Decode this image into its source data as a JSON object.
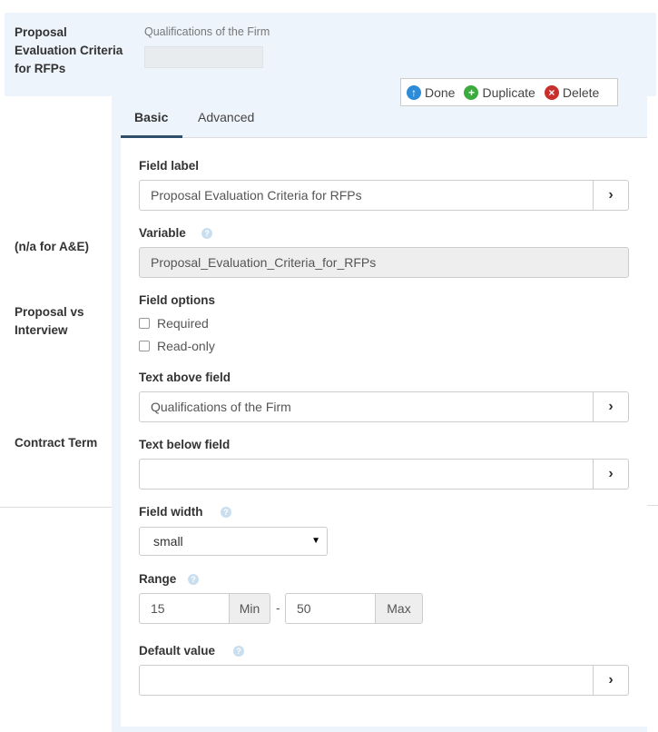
{
  "form": {
    "rows": [
      {
        "label": "Proposal\nEvaluation Criteria\nfor RFPs"
      },
      {
        "label": "(n/a for A&E)"
      },
      {
        "label": "Proposal vs\nInterview"
      },
      {
        "label": "Contract Term"
      }
    ],
    "preview_caption": "Qualifications of the Firm"
  },
  "toolbar": {
    "done_label": "Done",
    "duplicate_label": "Duplicate",
    "delete_label": "Delete",
    "done_icon": "arrow-up-circle-icon",
    "duplicate_icon": "plus-circle-icon",
    "delete_icon": "x-circle-icon"
  },
  "tabs": [
    {
      "label": "Basic",
      "active": true
    },
    {
      "label": "Advanced",
      "active": false
    }
  ],
  "fields": {
    "field_label": {
      "label": "Field label",
      "value": "Proposal Evaluation Criteria for RFPs"
    },
    "variable": {
      "label": "Variable",
      "value": "Proposal_Evaluation_Criteria_for_RFPs"
    },
    "field_options": {
      "label": "Field options",
      "required": "Required",
      "readonly": "Read-only"
    },
    "text_above": {
      "label": "Text above field",
      "value": "Qualifications of the Firm"
    },
    "text_below": {
      "label": "Text below field",
      "value": ""
    },
    "field_width": {
      "label": "Field width",
      "value": "small"
    },
    "range": {
      "label": "Range",
      "min": "15",
      "min_label": "Min",
      "separator": "-",
      "max": "50",
      "max_label": "Max"
    },
    "default_value": {
      "label": "Default value",
      "value": ""
    }
  },
  "chevron": "›",
  "help_glyph": "?",
  "colors": {
    "accent": "#2f4f6a",
    "done": "#2e8bd7",
    "duplicate": "#3caa3c",
    "delete": "#c9302c",
    "panel_bg": "#eef4fb"
  }
}
